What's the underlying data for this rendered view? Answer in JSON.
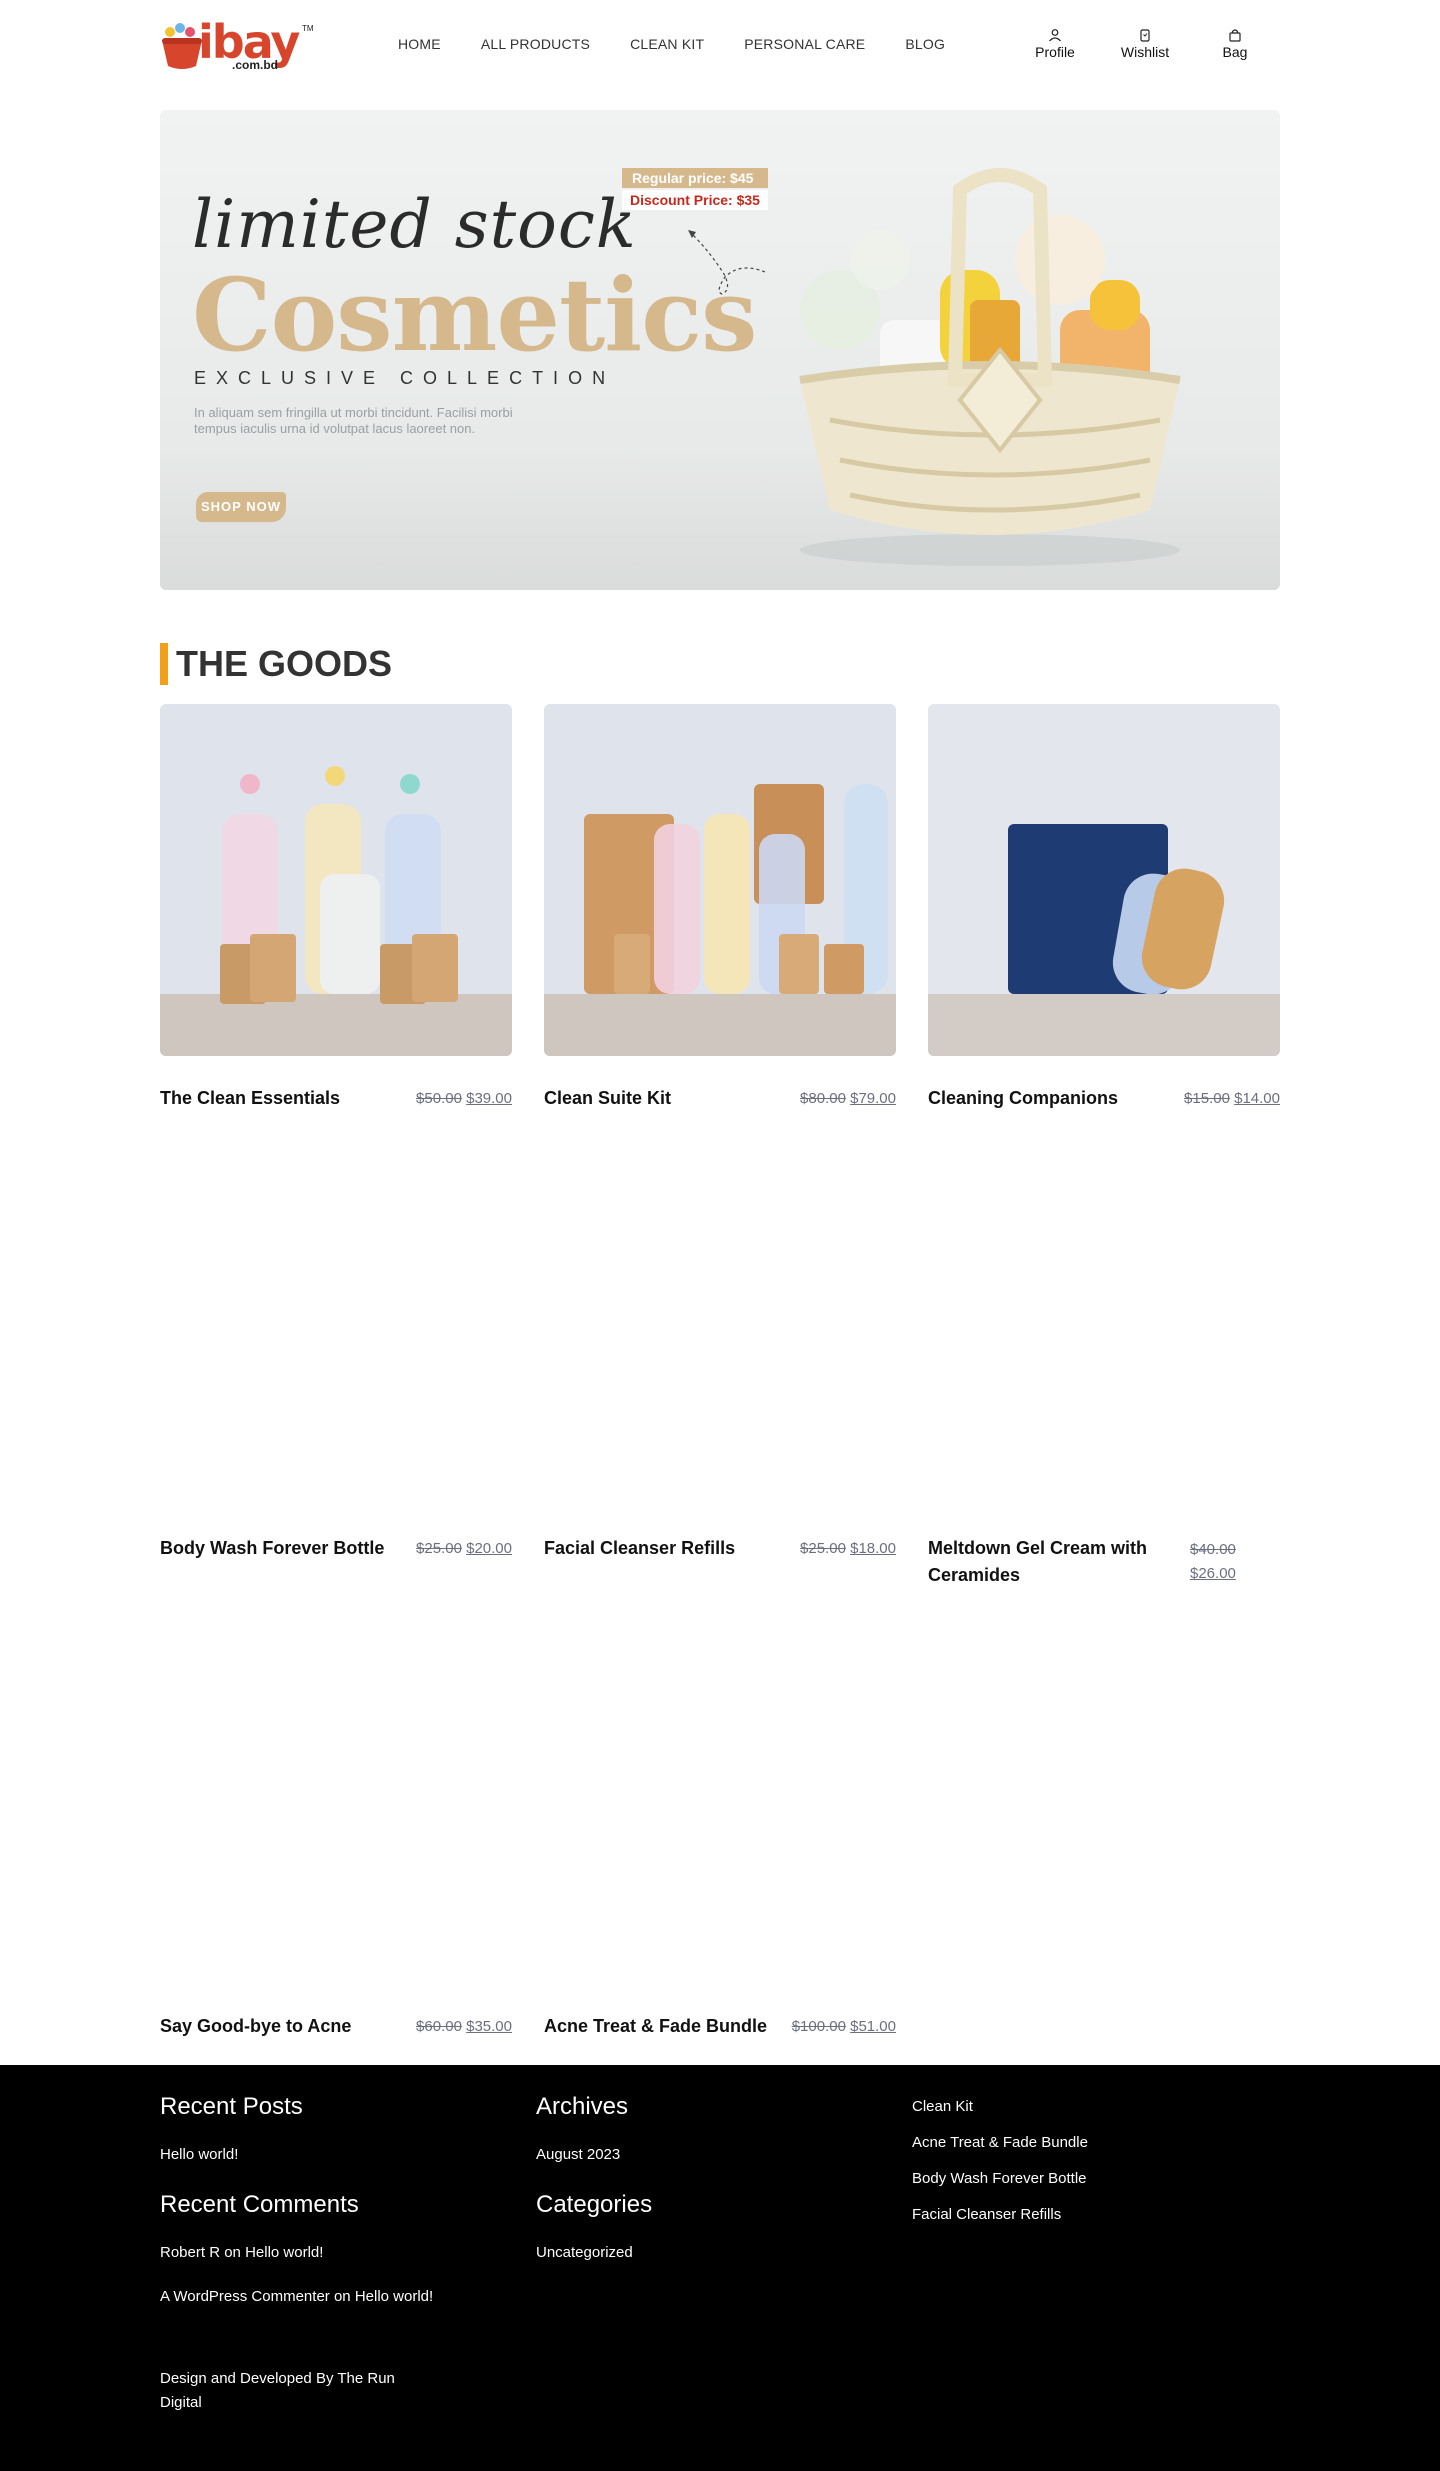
{
  "header": {
    "logo": {
      "text": "ibay",
      "sub": ".com.bd",
      "tm": "TM"
    },
    "nav": [
      "HOME",
      "ALL PRODUCTS",
      "CLEAN KIT",
      "PERSONAL CARE",
      "BLOG"
    ],
    "icons": {
      "profile": "Profile",
      "wishlist": "Wishlist",
      "bag": "Bag"
    }
  },
  "banner": {
    "script": "limited stock",
    "title": "Cosmetics",
    "collection": "EXCLUSIVE COLLECTION",
    "lorem": "In aliquam sem fringilla ut morbi tincidunt. Facilisi morbi tempus iaculis urna id volutpat lacus laoreet non.",
    "regular_price": "Regular price: $45",
    "discount_price": "Discount Price: $35",
    "shop_now": "SHOP NOW"
  },
  "section": {
    "title": "THE GOODS"
  },
  "products": [
    {
      "name": "The Clean Essentials",
      "old": "$50.00",
      "new": "$39.00"
    },
    {
      "name": "Clean Suite Kit",
      "old": "$80.00",
      "new": "$79.00"
    },
    {
      "name": "Cleaning Companions",
      "old": "$15.00",
      "new": "$14.00"
    },
    {
      "name": "Body Wash Forever Bottle",
      "old": "$25.00",
      "new": "$20.00"
    },
    {
      "name": "Facial Cleanser Refills",
      "old": "$25.00",
      "new": "$18.00"
    },
    {
      "name": "Meltdown Gel Cream with Ceramides",
      "old": "$40.00",
      "new": "$26.00"
    },
    {
      "name": "Say Good-bye to Acne",
      "old": "$60.00",
      "new": "$35.00"
    },
    {
      "name": "Acne Treat & Fade Bundle",
      "old": "$100.00",
      "new": "$51.00"
    }
  ],
  "footer": {
    "recent_posts": {
      "title": "Recent Posts",
      "items": [
        "Hello world!"
      ]
    },
    "recent_comments": {
      "title": "Recent Comments",
      "items": [
        {
          "author": "Robert R",
          "on": "on",
          "post": "Hello world!"
        },
        {
          "author": "A WordPress Commenter",
          "on": "on",
          "post": "Hello world!"
        }
      ]
    },
    "archives": {
      "title": "Archives",
      "items": [
        "August 2023"
      ]
    },
    "categories": {
      "title": "Categories",
      "items": [
        "Uncategorized"
      ]
    },
    "links": [
      "Clean Kit",
      "Acne Treat & Fade Bundle",
      "Body Wash Forever Bottle",
      "Facial Cleanser Refills"
    ],
    "credit": "Design and Developed By The Run Digital"
  },
  "colors": {
    "accent": "#f29f1a",
    "brand": "#d8452d",
    "gold": "#d6b88d",
    "footer_bg": "#000000"
  }
}
